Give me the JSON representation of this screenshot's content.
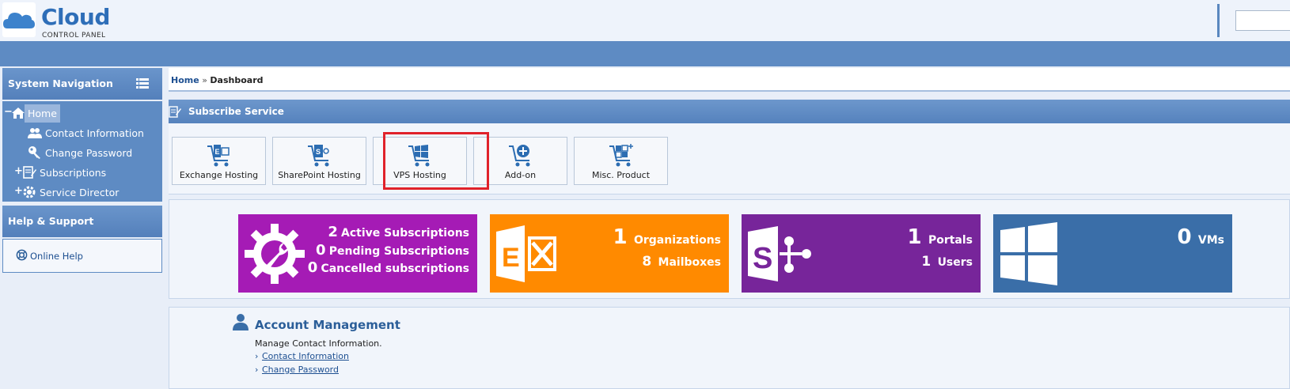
{
  "logo": {
    "main": "Cloud",
    "sub": "CONTROL PANEL"
  },
  "sidebar": {
    "nav_title": "System Navigation",
    "items": [
      {
        "toggle": "−",
        "label": "Home"
      },
      {
        "label": "Contact Information"
      },
      {
        "label": "Change Password"
      },
      {
        "toggle": "+",
        "label": "Subscriptions"
      },
      {
        "toggle": "+",
        "label": "Service Director"
      }
    ],
    "help_title": "Help & Support",
    "help_link": "Online Help"
  },
  "breadcrumb": {
    "home": "Home",
    "sep": "»",
    "current": "Dashboard"
  },
  "subscribe": {
    "title": "Subscribe Service",
    "buttons": [
      {
        "label": "Exchange Hosting",
        "icon": "exchange-cart-icon"
      },
      {
        "label": "SharePoint Hosting",
        "icon": "sharepoint-cart-icon"
      },
      {
        "label": "VPS Hosting",
        "icon": "windows-cart-icon"
      },
      {
        "label": "Add-on",
        "icon": "add-cart-icon"
      },
      {
        "label": "Misc. Product",
        "icon": "misc-cart-icon"
      }
    ]
  },
  "tiles": {
    "subscriptions": {
      "color": "#a51bb5",
      "rows": [
        {
          "num": "2",
          "text": "Active Subscriptions"
        },
        {
          "num": "0",
          "text": "Pending Subscriptions"
        },
        {
          "num": "0",
          "text": "Cancelled subscriptions"
        }
      ]
    },
    "exchange": {
      "color": "#ff8a00",
      "rows": [
        {
          "num": "1",
          "text": "Organizations"
        },
        {
          "num": "8",
          "text": "Mailboxes"
        }
      ]
    },
    "sharepoint": {
      "color": "#77259a",
      "rows": [
        {
          "num": "1",
          "text": "Portals"
        },
        {
          "num": "1",
          "text": "Users"
        }
      ]
    },
    "vps": {
      "color": "#3a6ea8",
      "rows": [
        {
          "num": "0",
          "text": "VMs"
        }
      ]
    }
  },
  "account": {
    "title": "Account Management",
    "description": "Manage Contact Information.",
    "links": [
      "Contact Information",
      "Change Password"
    ],
    "chevron": "›"
  }
}
